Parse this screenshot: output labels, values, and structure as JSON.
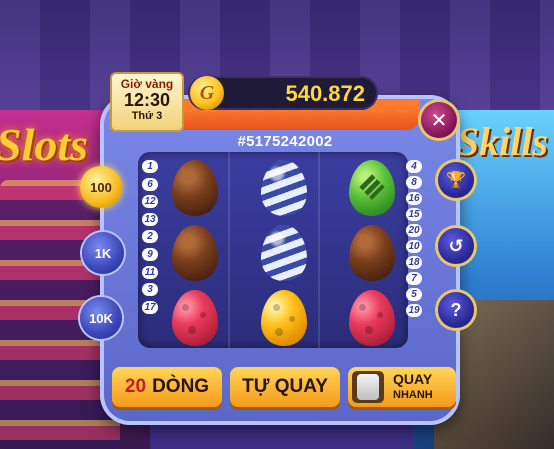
{
  "background": {
    "left_game_title": "Slots",
    "right_game_title": "Skills"
  },
  "time_box": {
    "title": "Giờ vàng",
    "time": "12:30",
    "day": "Thứ 3"
  },
  "balance": {
    "coin_symbol": "G",
    "amount": "540.872"
  },
  "game_id": "#5175242002",
  "line_numbers": {
    "left": [
      "1",
      "6",
      "12",
      "13",
      "2",
      "9",
      "11",
      "3",
      "17"
    ],
    "right": [
      "4",
      "8",
      "16",
      "15",
      "20",
      "10",
      "18",
      "7",
      "5",
      "19"
    ]
  },
  "reels": [
    [
      "egg-brown",
      "egg-brown",
      "egg-red"
    ],
    [
      "egg-blue-striped",
      "egg-blue-striped",
      "egg-yellow"
    ],
    [
      "egg-green",
      "egg-brown",
      "egg-red"
    ]
  ],
  "bet_chips": [
    "100",
    "1K",
    "10K"
  ],
  "side_buttons": {
    "close": "✕",
    "trophy": "🏆",
    "history": "↺",
    "help": "?"
  },
  "controls": {
    "lines_count": "20",
    "lines_label": "DÒNG",
    "auto_spin": "TỰ QUAY",
    "quick_spin_1": "QUAY",
    "quick_spin_2": "NHANH"
  },
  "colors": {
    "accent_gold": "#ffd83a",
    "button_orange": "#f59a1a"
  }
}
